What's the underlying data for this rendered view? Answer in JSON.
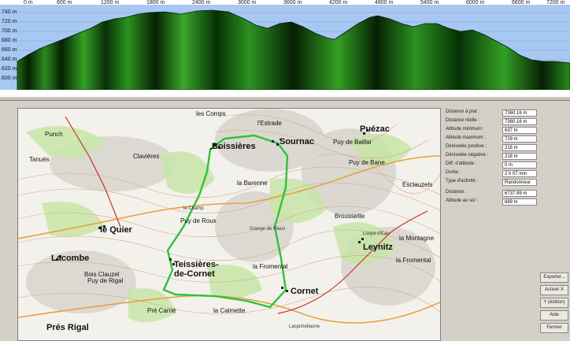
{
  "profile": {
    "x_labels": [
      "0 m",
      "600 m",
      "1200 m",
      "1800 m",
      "2400 m",
      "3000 m",
      "3600 m",
      "4200 m",
      "4800 m",
      "5400 m",
      "6000 m",
      "6600 m",
      "7200 m"
    ],
    "y_labels": [
      "740 m",
      "720 m",
      "700 m",
      "680 m",
      "660 m",
      "640 m",
      "620 m",
      "600 m"
    ],
    "colors": {
      "sky": "#a8c8f4",
      "fill_dark": "#0a2a06",
      "fill_light": "#3aa02a"
    }
  },
  "stats": {
    "rows": [
      {
        "label": "Distance à plat :",
        "value": "7360.16 m"
      },
      {
        "label": "Distance réelle :",
        "value": "7380.16 m"
      },
      {
        "label": "Altitude minimum :",
        "value": "637 m"
      },
      {
        "label": "Altitude maximum :",
        "value": "729 m"
      },
      {
        "label": "Dénivelée positive :",
        "value": "218 m"
      },
      {
        "label": "Dénivelée négative :",
        "value": "218 m"
      },
      {
        "label": "Diff. d'altitude :",
        "value": "0 m"
      },
      {
        "label": "Durée :",
        "value": "2 h 07 min"
      },
      {
        "label": "Type d'activité :",
        "value": "Randonneur"
      },
      {
        "label": "Distance :",
        "value": "6737.99 m"
      },
      {
        "label": "Altitude au sol :",
        "value": "689 m"
      }
    ]
  },
  "map": {
    "places": [
      {
        "text": "Boissières",
        "cls": "big"
      },
      {
        "text": "Sournac",
        "cls": "big"
      },
      {
        "text": "Puézac",
        "cls": "big"
      },
      {
        "text": "Clavières",
        "cls": ""
      },
      {
        "text": "le Quier",
        "cls": "big"
      },
      {
        "text": "Lacombe",
        "cls": "big"
      },
      {
        "text": "Teissières-",
        "cls": "big"
      },
      {
        "text": "de-Cornet",
        "cls": "big"
      },
      {
        "text": "Cornet",
        "cls": "big"
      },
      {
        "text": "Leynitz",
        "cls": "big"
      },
      {
        "text": "la Barenne",
        "cls": ""
      },
      {
        "text": "Broussette",
        "cls": ""
      },
      {
        "text": "Puy de Roux",
        "cls": ""
      },
      {
        "text": "la Fromental",
        "cls": ""
      },
      {
        "text": "la Calmette",
        "cls": ""
      },
      {
        "text": "Prés Rigal",
        "cls": "big"
      },
      {
        "text": "les Comps",
        "cls": ""
      },
      {
        "text": "l'Estrade",
        "cls": ""
      },
      {
        "text": "Puy de Baillar",
        "cls": ""
      },
      {
        "text": "Puy de Bane",
        "cls": ""
      },
      {
        "text": "Esclauzels",
        "cls": ""
      },
      {
        "text": "Tanuès",
        "cls": ""
      },
      {
        "text": "Punch",
        "cls": ""
      },
      {
        "text": "Puy de Rigal",
        "cls": ""
      },
      {
        "text": "Bois Clauzel",
        "cls": ""
      },
      {
        "text": "la Montagne",
        "cls": ""
      },
      {
        "text": "la Fromental",
        "cls": ""
      },
      {
        "text": "Loupe d'Eau",
        "cls": ""
      },
      {
        "text": "Pré Carrié",
        "cls": ""
      },
      {
        "text": "Lacpchetlaune",
        "cls": ""
      },
      {
        "text": "le Champ",
        "cls": ""
      },
      {
        "text": "Grange de Rieux",
        "cls": ""
      }
    ]
  },
  "buttons": [
    "Exporter...",
    "Activer X",
    "Y (édition)",
    "Aide",
    "Fermer"
  ]
}
